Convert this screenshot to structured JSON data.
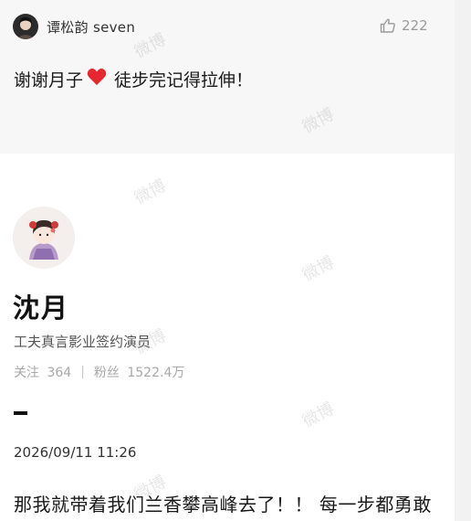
{
  "comment": {
    "user_name": "谭松韵 seven",
    "like_count": "222",
    "text_before": "谢谢月子",
    "emoji": "heart-icon",
    "text_after": "徒步完记得拉伸！"
  },
  "profile": {
    "name": "沈月",
    "certification": "工夫真言影业签约演员",
    "following_label": "关注",
    "following_count": "364",
    "followers_label": "粉丝",
    "followers_count": "1522.4万"
  },
  "post": {
    "timestamp": "2026/09/11 11:26",
    "text": "那我就带着我们兰香攀高峰去了！！ 每一步都勇敢"
  },
  "watermark": {
    "text": "微博"
  },
  "colors": {
    "heart": "#e8262e",
    "card_background": "#f7f7f7"
  }
}
